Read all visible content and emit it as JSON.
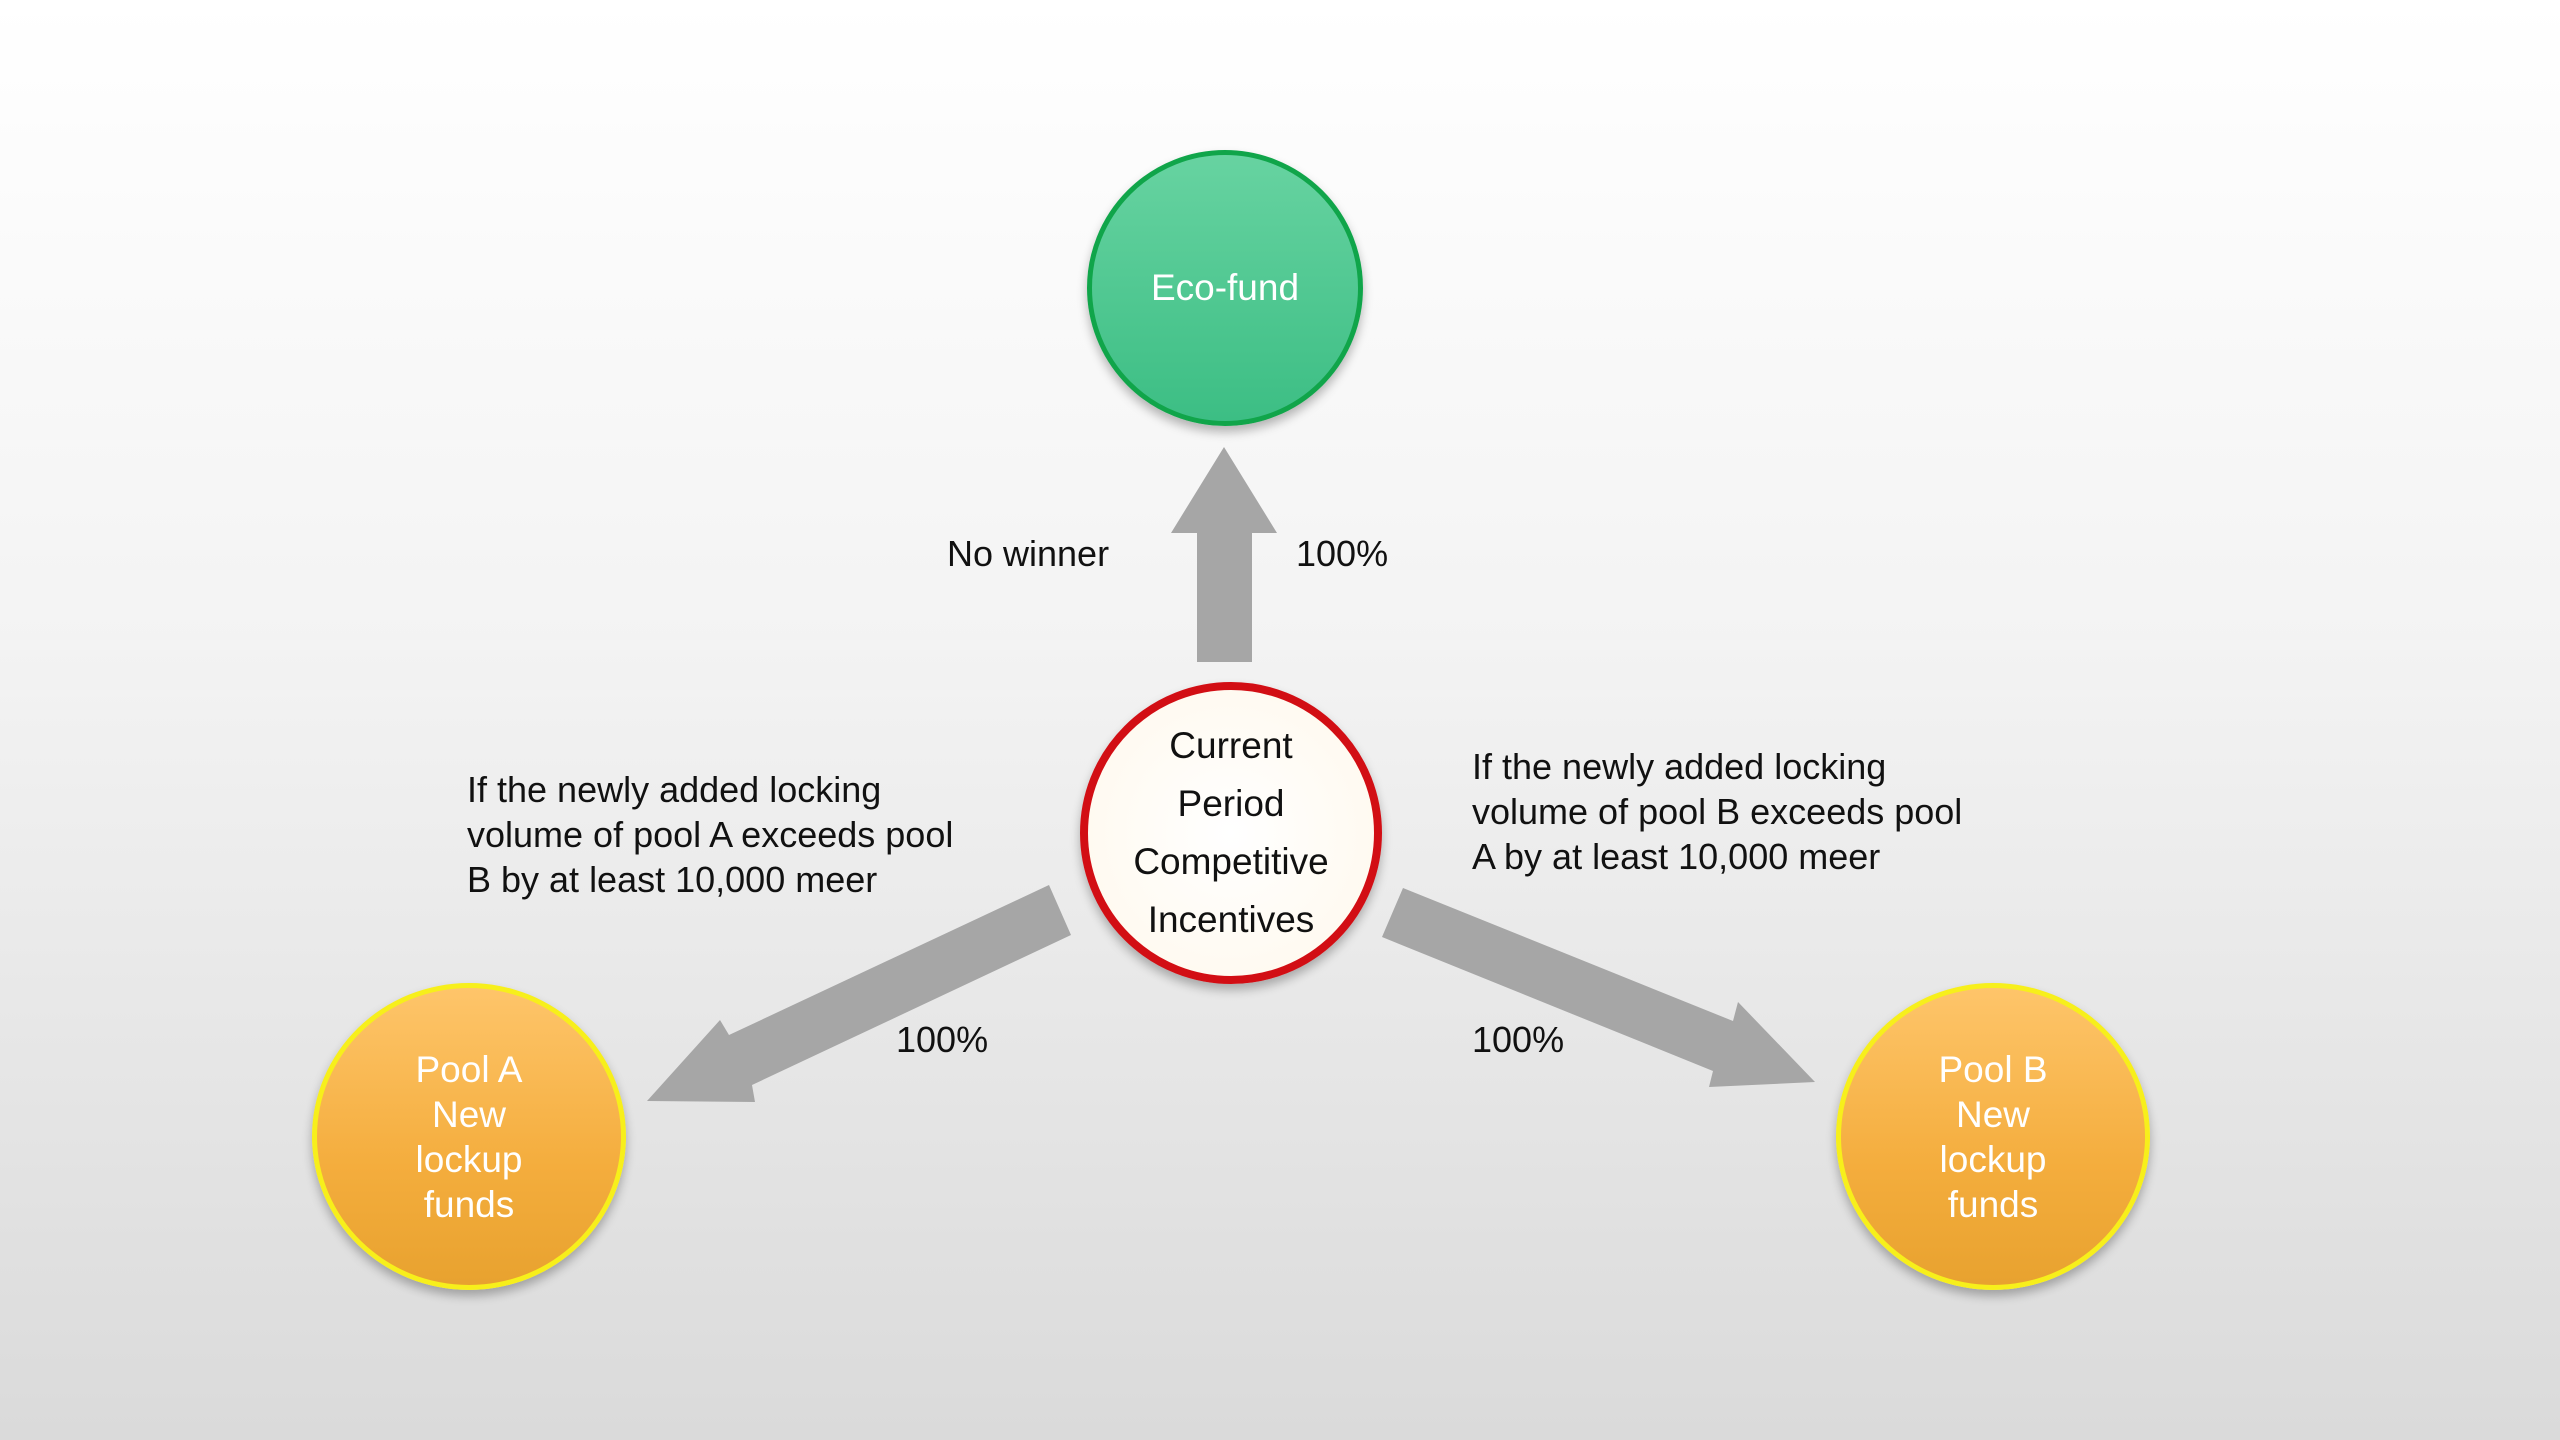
{
  "nodes": {
    "eco_fund": {
      "label": "Eco-fund"
    },
    "current": {
      "lines": [
        "Current",
        "Period",
        "Competitive",
        "Incentives"
      ]
    },
    "pool_a": {
      "lines": [
        "Pool A",
        "New",
        "lockup",
        "funds"
      ]
    },
    "pool_b": {
      "lines": [
        "Pool B",
        "New",
        "lockup",
        "funds"
      ]
    }
  },
  "edges": {
    "to_eco_fund": {
      "condition": "No winner",
      "share": "100%"
    },
    "to_pool_a": {
      "condition": "If the newly added locking volume of pool A exceeds pool B by at least 10,000 meer",
      "condition_lines": [
        "If the newly added locking",
        "volume of pool A exceeds pool",
        "B by at least 10,000 meer"
      ],
      "share": "100%"
    },
    "to_pool_b": {
      "condition": "If the newly added locking volume of pool B exceeds pool A by at least 10,000 meer",
      "condition_lines": [
        "If the newly added locking",
        "volume of pool B exceeds pool",
        "A by at least 10,000 meer"
      ],
      "share": "100%"
    }
  },
  "colors": {
    "eco_fund_fill": "#4ec68f",
    "eco_fund_border": "#10a54a",
    "current_border": "#d20e14",
    "pool_fill": "#f6b449",
    "pool_border": "#f7ef1b",
    "arrow": "#a6a6a6"
  }
}
